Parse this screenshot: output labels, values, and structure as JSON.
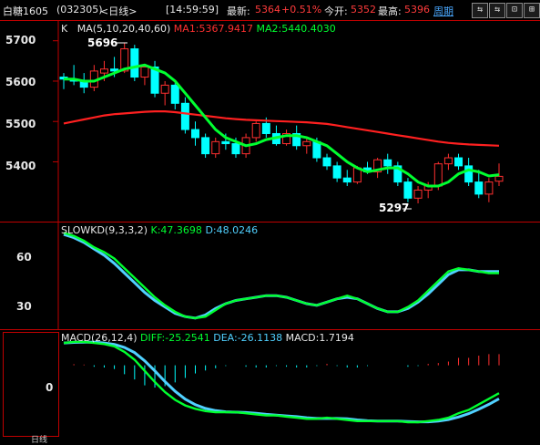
{
  "header": {
    "symbol": "白糖1605",
    "code": "(032305)",
    "period": "<日线>",
    "time": "[14:59:59]",
    "latest_label": "最新:",
    "latest_value": "5364",
    "change": "+0.51%",
    "open_label": "今开:",
    "open_value": "5352",
    "high_label": "最高:",
    "high_value": "5396",
    "cycle_link": "周期",
    "nav_buttons": [
      "⇆",
      "⇆",
      "⊡",
      "⊞"
    ]
  },
  "colors": {
    "background": "#000000",
    "border": "#c00000",
    "up": "#ff3030",
    "down": "#00ffff",
    "ma_red": "#ff2020",
    "ma_green": "#00ff30",
    "ma_magenta": "#ff00ff",
    "ma_cyan": "#50d0ff"
  },
  "price_panel": {
    "legend_k": "K",
    "legend_ma": "MA(5,10,20,40,60)",
    "legend_ma1": "MA1:5367.9417",
    "legend_ma2": "MA2:5440.4030",
    "ticks": [
      "5700",
      "5600",
      "5500",
      "5400"
    ],
    "high_annotation": "5696",
    "low_annotation": "5297"
  },
  "kd_panel": {
    "legend_name": "SLOWKD(9,3,3,2)",
    "legend_k": "K:47.3698",
    "legend_d": "D:48.0246",
    "ticks": [
      "60",
      "30"
    ]
  },
  "macd_panel": {
    "legend_name": "MACD(26,12,4)",
    "legend_diff": "DIFF:-25.2541",
    "legend_dea": "DEA:-26.1138",
    "legend_macd": "MACD:1.7194",
    "ticks": [
      "0"
    ],
    "bottom_label": "日线"
  },
  "chart_data": {
    "type": "candlestick",
    "price_range": [
      5270,
      5740
    ],
    "candles": [
      [
        5610,
        5620,
        5580,
        5605
      ],
      [
        5605,
        5640,
        5590,
        5600
      ],
      [
        5600,
        5620,
        5570,
        5585
      ],
      [
        5585,
        5640,
        5575,
        5625
      ],
      [
        5620,
        5650,
        5600,
        5630
      ],
      [
        5630,
        5660,
        5610,
        5625
      ],
      [
        5625,
        5696,
        5620,
        5680
      ],
      [
        5680,
        5690,
        5600,
        5610
      ],
      [
        5610,
        5640,
        5590,
        5635
      ],
      [
        5635,
        5650,
        5560,
        5570
      ],
      [
        5570,
        5600,
        5540,
        5590
      ],
      [
        5590,
        5595,
        5530,
        5545
      ],
      [
        5545,
        5560,
        5470,
        5480
      ],
      [
        5480,
        5500,
        5440,
        5460
      ],
      [
        5460,
        5470,
        5410,
        5420
      ],
      [
        5420,
        5460,
        5410,
        5450
      ],
      [
        5450,
        5470,
        5430,
        5445
      ],
      [
        5445,
        5460,
        5410,
        5420
      ],
      [
        5420,
        5470,
        5410,
        5460
      ],
      [
        5460,
        5500,
        5450,
        5495
      ],
      [
        5495,
        5510,
        5460,
        5470
      ],
      [
        5470,
        5490,
        5440,
        5445
      ],
      [
        5445,
        5480,
        5440,
        5470
      ],
      [
        5470,
        5490,
        5430,
        5440
      ],
      [
        5440,
        5460,
        5420,
        5450
      ],
      [
        5450,
        5460,
        5400,
        5410
      ],
      [
        5410,
        5420,
        5380,
        5390
      ],
      [
        5390,
        5400,
        5350,
        5360
      ],
      [
        5360,
        5380,
        5340,
        5350
      ],
      [
        5350,
        5390,
        5345,
        5385
      ],
      [
        5385,
        5400,
        5370,
        5375
      ],
      [
        5375,
        5410,
        5360,
        5405
      ],
      [
        5405,
        5420,
        5370,
        5390
      ],
      [
        5390,
        5400,
        5340,
        5350
      ],
      [
        5350,
        5360,
        5300,
        5310
      ],
      [
        5310,
        5340,
        5297,
        5330
      ],
      [
        5330,
        5350,
        5310,
        5340
      ],
      [
        5340,
        5400,
        5330,
        5395
      ],
      [
        5395,
        5420,
        5380,
        5410
      ],
      [
        5410,
        5420,
        5380,
        5390
      ],
      [
        5390,
        5410,
        5340,
        5350
      ],
      [
        5350,
        5380,
        5310,
        5320
      ],
      [
        5320,
        5360,
        5300,
        5350
      ],
      [
        5352,
        5396,
        5340,
        5364
      ]
    ],
    "ma_short": [
      5605,
      5605,
      5600,
      5600,
      5610,
      5620,
      5630,
      5635,
      5640,
      5630,
      5620,
      5600,
      5570,
      5540,
      5510,
      5480,
      5460,
      5450,
      5440,
      5445,
      5455,
      5460,
      5465,
      5465,
      5460,
      5450,
      5440,
      5420,
      5400,
      5385,
      5375,
      5380,
      5385,
      5385,
      5370,
      5350,
      5340,
      5340,
      5350,
      5370,
      5380,
      5375,
      5365,
      5368
    ],
    "ma_long": [
      5495,
      5500,
      5505,
      5510,
      5515,
      5518,
      5520,
      5522,
      5524,
      5525,
      5525,
      5523,
      5520,
      5517,
      5514,
      5511,
      5508,
      5506,
      5504,
      5503,
      5502,
      5501,
      5500,
      5499,
      5498,
      5496,
      5494,
      5490,
      5486,
      5482,
      5478,
      5474,
      5470,
      5466,
      5462,
      5458,
      5454,
      5450,
      5447,
      5445,
      5443,
      5442,
      5441,
      5440
    ],
    "kd_range": [
      15,
      75
    ],
    "kd_k": [
      72,
      70,
      67,
      63,
      60,
      56,
      50,
      44,
      38,
      32,
      27,
      23,
      20,
      19,
      20,
      24,
      28,
      30,
      31,
      32,
      33,
      33,
      32,
      30,
      28,
      27,
      29,
      31,
      33,
      31,
      28,
      25,
      23,
      23,
      26,
      30,
      36,
      42,
      48,
      50,
      49,
      48,
      47,
      47
    ],
    "kd_d": [
      71,
      69,
      66,
      62,
      58,
      53,
      47,
      41,
      35,
      30,
      26,
      22,
      20,
      19,
      21,
      25,
      28,
      30,
      31,
      32,
      33,
      33,
      32,
      30,
      28,
      27,
      29,
      31,
      32,
      31,
      28,
      25,
      23,
      23,
      25,
      29,
      34,
      40,
      46,
      49,
      49,
      48,
      48,
      48
    ],
    "macd_range": [
      -60,
      25
    ],
    "diff": [
      20,
      21,
      21,
      20,
      19,
      17,
      12,
      5,
      -5,
      -15,
      -24,
      -31,
      -36,
      -39,
      -41,
      -42,
      -42,
      -42,
      -43,
      -44,
      -45,
      -45,
      -46,
      -47,
      -48,
      -48,
      -47,
      -48,
      -49,
      -50,
      -50,
      -50,
      -50,
      -50,
      -51,
      -51,
      -50,
      -49,
      -47,
      -43,
      -40,
      -35,
      -30,
      -25
    ]
  }
}
